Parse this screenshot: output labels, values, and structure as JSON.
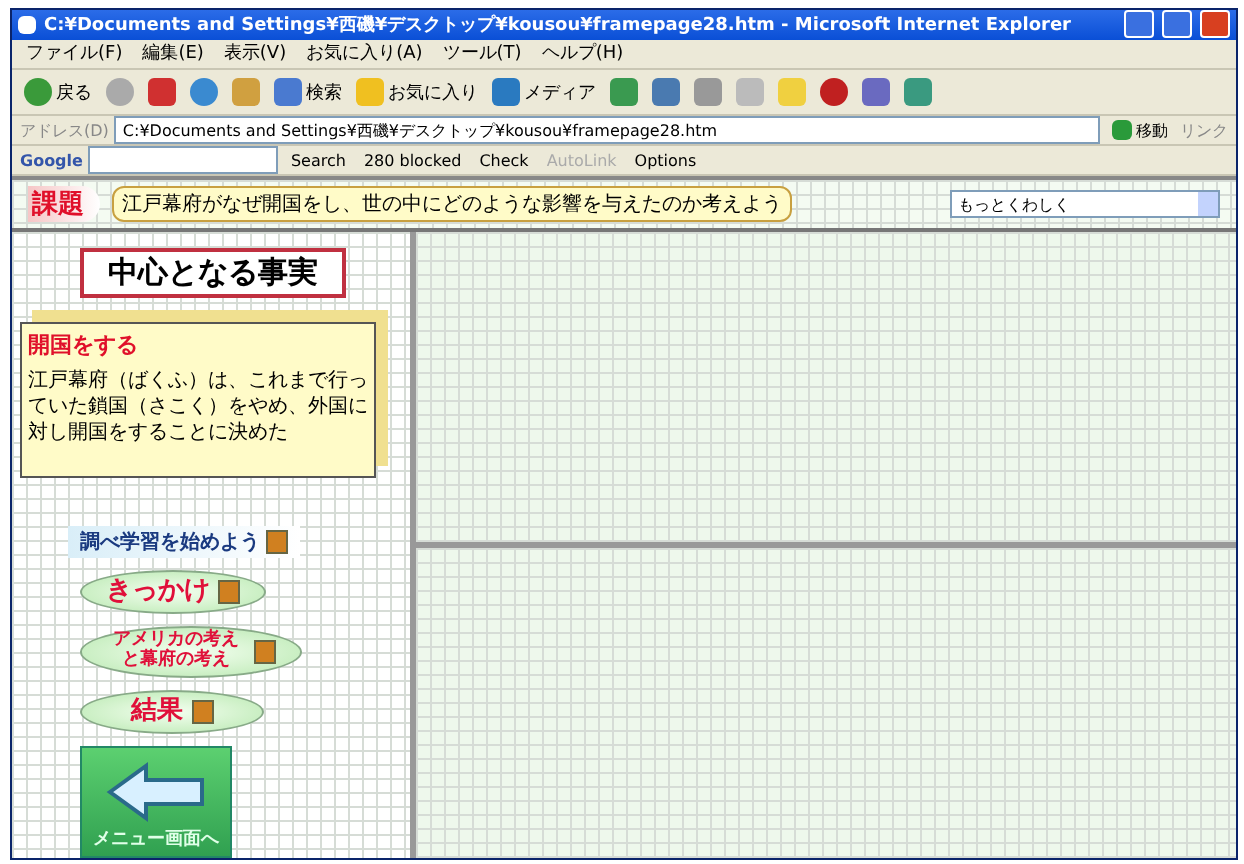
{
  "window": {
    "title": "C:¥Documents and Settings¥西磯¥デスクトップ¥kousou¥framepage28.htm - Microsoft Internet Explorer"
  },
  "menu": [
    "ファイル(F)",
    "編集(E)",
    "表示(V)",
    "お気に入り(A)",
    "ツール(T)",
    "ヘルプ(H)"
  ],
  "toolbar": [
    {
      "kind": "back",
      "label": "戻る"
    },
    {
      "kind": "forward"
    },
    {
      "kind": "stop"
    },
    {
      "kind": "refresh"
    },
    {
      "kind": "home"
    },
    {
      "kind": "search",
      "label": "検索"
    },
    {
      "kind": "favorites",
      "label": "お気に入り"
    },
    {
      "kind": "media",
      "label": "メディア"
    },
    {
      "kind": "history"
    },
    {
      "kind": "mail"
    },
    {
      "kind": "print"
    },
    {
      "kind": "edit"
    },
    {
      "kind": "note"
    },
    {
      "kind": "power"
    },
    {
      "kind": "messenger"
    },
    {
      "kind": "people"
    }
  ],
  "address_bar": {
    "label": "アドレス(D)",
    "value": "C:¥Documents and Settings¥西磯¥デスクトップ¥kousou¥framepage28.htm",
    "go": "移動",
    "links": "リンク"
  },
  "google_bar": {
    "logo": "Google",
    "search": "Search",
    "blocked": "280 blocked",
    "check": "Check",
    "autolink": "AutoLink",
    "options": "Options"
  },
  "page": {
    "task_label": "課題",
    "task": "江戸幕府がなぜ開国をし、世の中にどのような影響を与えたのか考えよう",
    "select": "もっとくわしく",
    "fact_heading": "中心となる事実",
    "fact_title": "開国をする",
    "fact_text": "江戸幕府（ばくふ）は、これまで行っていた鎖国（さこく）をやめ、外国に対し開国をすることに決めた",
    "study_label": "調べ学習を始めよう",
    "buttons": [
      "きっかけ",
      "アメリカの考えと幕府の考え",
      "結果"
    ],
    "menu_button": "メニュー画面へ"
  }
}
